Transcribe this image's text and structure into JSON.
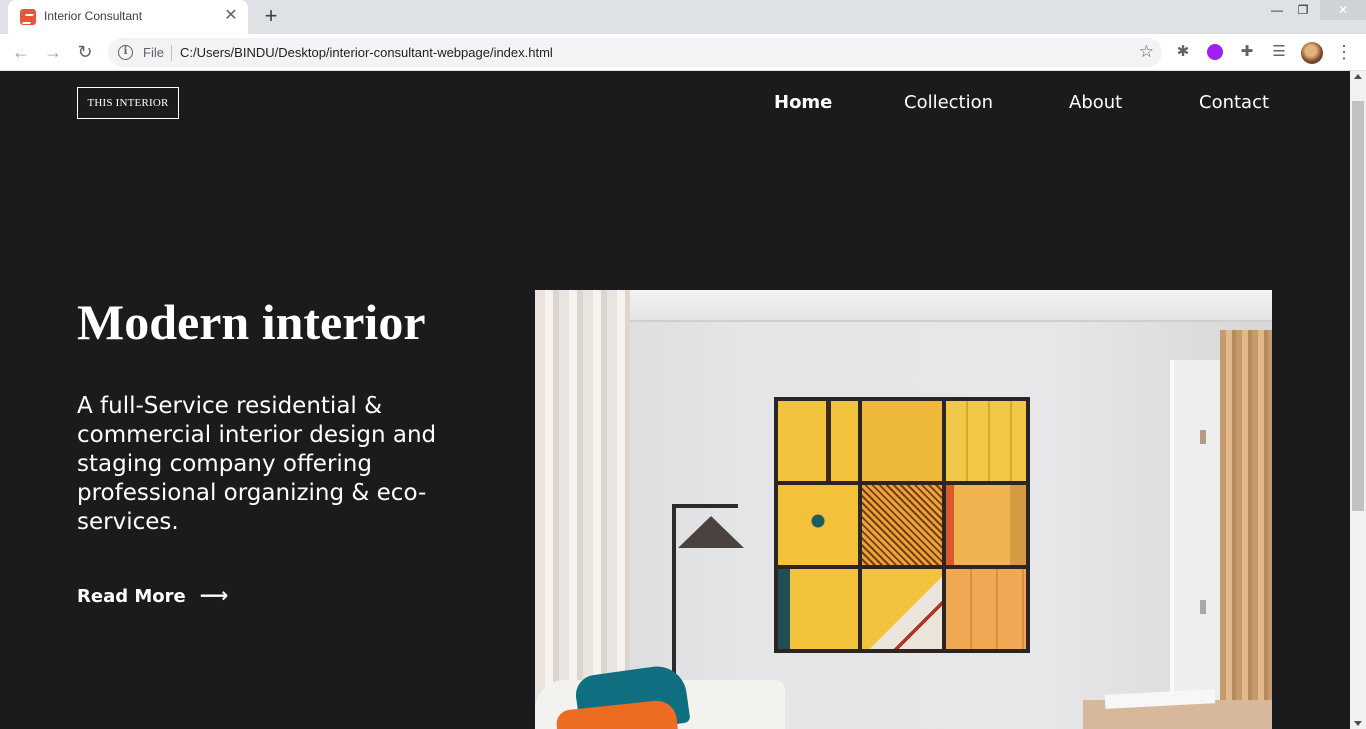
{
  "browser": {
    "tab_title": "Interior Consultant",
    "tab_close": "✕",
    "new_tab": "+",
    "window_minimize": "—",
    "window_maximize": "❐",
    "window_close": "✕",
    "nav_back": "←",
    "nav_forward": "→",
    "nav_reload": "↻",
    "info_icon": "i",
    "scheme_label": "File",
    "url": "C:/Users/BINDU/Desktop/interior-consultant-webpage/index.html",
    "star_icon": "☆",
    "menu_icon": "⋮",
    "extension_icons": [
      "bug-icon",
      "purple-circle-icon",
      "puzzle-icon",
      "media-control-icon"
    ]
  },
  "site": {
    "logo": "THIS INTERIOR",
    "nav": {
      "home": "Home",
      "collection": "Collection",
      "about": "About",
      "contact": "Contact"
    },
    "hero": {
      "title": "Modern interior",
      "description": "A full-Service residential & commercial interior design and staging company offering professional organizing & eco-services.",
      "cta_label": "Read More",
      "cta_arrow": "⟶"
    }
  },
  "colors": {
    "page_background": "#1b1a1d",
    "text": "#ffffff",
    "favicon": "#e8553d"
  }
}
